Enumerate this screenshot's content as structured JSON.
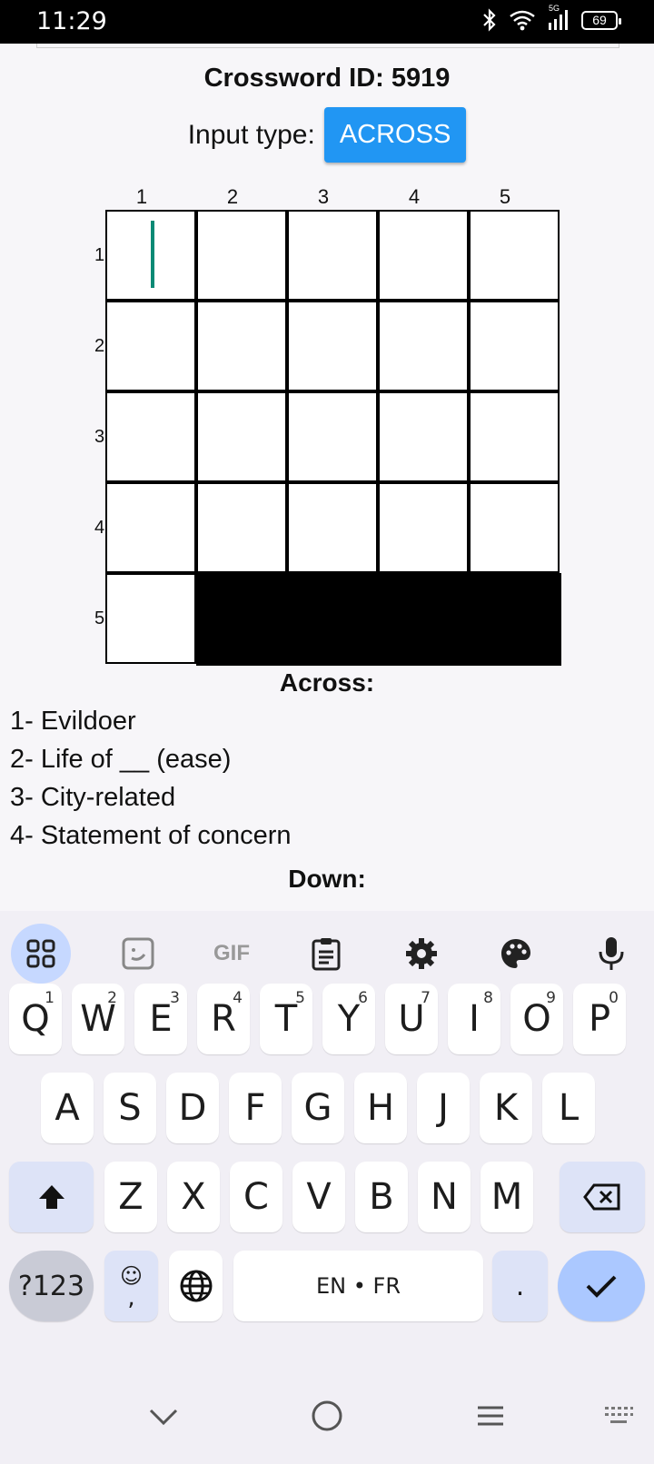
{
  "status": {
    "time": "11:29",
    "battery": "69",
    "network": "5G"
  },
  "app": {
    "title": "Crossword ID: 5919",
    "input_type_label": "Input type:",
    "input_type_button": "ACROSS",
    "col_numbers": [
      "1",
      "2",
      "3",
      "4",
      "5"
    ],
    "row_numbers": [
      "1",
      "2",
      "3",
      "4",
      "5"
    ],
    "grid": [
      [
        "",
        "",
        "",
        "",
        ""
      ],
      [
        "",
        "",
        "",
        "",
        ""
      ],
      [
        "",
        "",
        "",
        "",
        ""
      ],
      [
        "",
        "",
        "",
        "",
        ""
      ],
      [
        "",
        "#",
        "#",
        "#",
        "#"
      ]
    ],
    "across_heading": "Across:",
    "across_clues": [
      "1- Evildoer",
      "2- Life of __ (ease)",
      "3- City-related",
      "4- Statement of concern"
    ],
    "down_heading": "Down:"
  },
  "keyboard": {
    "toolbar": [
      "apps-icon",
      "sticker-icon",
      "gif-icon",
      "clipboard-icon",
      "gear-icon",
      "palette-icon",
      "microphone-icon"
    ],
    "gif_label": "GIF",
    "row1": [
      {
        "k": "Q",
        "s": "1"
      },
      {
        "k": "W",
        "s": "2"
      },
      {
        "k": "E",
        "s": "3"
      },
      {
        "k": "R",
        "s": "4"
      },
      {
        "k": "T",
        "s": "5"
      },
      {
        "k": "Y",
        "s": "6"
      },
      {
        "k": "U",
        "s": "7"
      },
      {
        "k": "I",
        "s": "8"
      },
      {
        "k": "O",
        "s": "9"
      },
      {
        "k": "P",
        "s": "0"
      }
    ],
    "row2": [
      "A",
      "S",
      "D",
      "F",
      "G",
      "H",
      "J",
      "K",
      "L"
    ],
    "row3": [
      "Z",
      "X",
      "C",
      "V",
      "B",
      "N",
      "M"
    ],
    "sym_label": "?123",
    "comma_label": ",",
    "space_label": "EN • FR",
    "period_label": "."
  },
  "colors": {
    "accent": "#2196f3",
    "caret": "#0a8a75",
    "enter": "#abc8ff"
  }
}
